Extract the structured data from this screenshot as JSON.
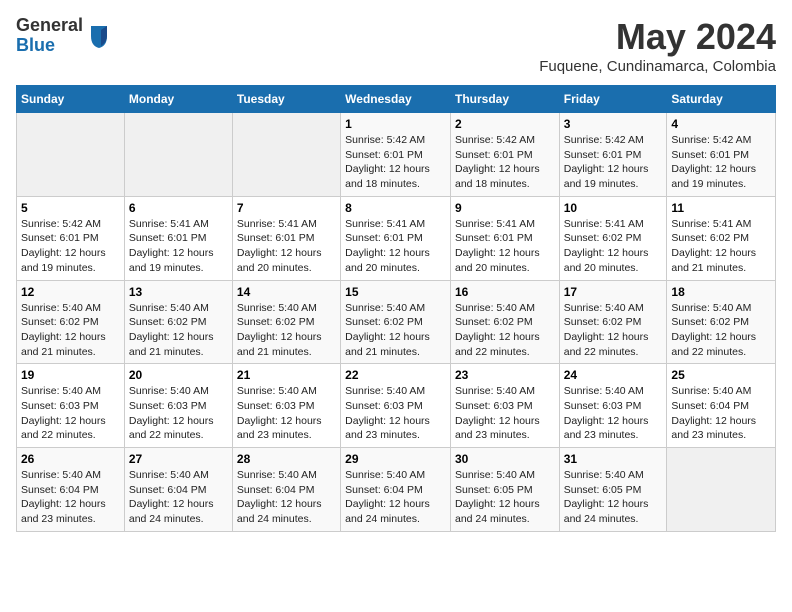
{
  "logo": {
    "general": "General",
    "blue": "Blue"
  },
  "title": "May 2024",
  "location": "Fuquene, Cundinamarca, Colombia",
  "days_of_week": [
    "Sunday",
    "Monday",
    "Tuesday",
    "Wednesday",
    "Thursday",
    "Friday",
    "Saturday"
  ],
  "weeks": [
    [
      {
        "day": "",
        "info": ""
      },
      {
        "day": "",
        "info": ""
      },
      {
        "day": "",
        "info": ""
      },
      {
        "day": "1",
        "info": "Sunrise: 5:42 AM\nSunset: 6:01 PM\nDaylight: 12 hours\nand 18 minutes."
      },
      {
        "day": "2",
        "info": "Sunrise: 5:42 AM\nSunset: 6:01 PM\nDaylight: 12 hours\nand 18 minutes."
      },
      {
        "day": "3",
        "info": "Sunrise: 5:42 AM\nSunset: 6:01 PM\nDaylight: 12 hours\nand 19 minutes."
      },
      {
        "day": "4",
        "info": "Sunrise: 5:42 AM\nSunset: 6:01 PM\nDaylight: 12 hours\nand 19 minutes."
      }
    ],
    [
      {
        "day": "5",
        "info": "Sunrise: 5:42 AM\nSunset: 6:01 PM\nDaylight: 12 hours\nand 19 minutes."
      },
      {
        "day": "6",
        "info": "Sunrise: 5:41 AM\nSunset: 6:01 PM\nDaylight: 12 hours\nand 19 minutes."
      },
      {
        "day": "7",
        "info": "Sunrise: 5:41 AM\nSunset: 6:01 PM\nDaylight: 12 hours\nand 20 minutes."
      },
      {
        "day": "8",
        "info": "Sunrise: 5:41 AM\nSunset: 6:01 PM\nDaylight: 12 hours\nand 20 minutes."
      },
      {
        "day": "9",
        "info": "Sunrise: 5:41 AM\nSunset: 6:01 PM\nDaylight: 12 hours\nand 20 minutes."
      },
      {
        "day": "10",
        "info": "Sunrise: 5:41 AM\nSunset: 6:02 PM\nDaylight: 12 hours\nand 20 minutes."
      },
      {
        "day": "11",
        "info": "Sunrise: 5:41 AM\nSunset: 6:02 PM\nDaylight: 12 hours\nand 21 minutes."
      }
    ],
    [
      {
        "day": "12",
        "info": "Sunrise: 5:40 AM\nSunset: 6:02 PM\nDaylight: 12 hours\nand 21 minutes."
      },
      {
        "day": "13",
        "info": "Sunrise: 5:40 AM\nSunset: 6:02 PM\nDaylight: 12 hours\nand 21 minutes."
      },
      {
        "day": "14",
        "info": "Sunrise: 5:40 AM\nSunset: 6:02 PM\nDaylight: 12 hours\nand 21 minutes."
      },
      {
        "day": "15",
        "info": "Sunrise: 5:40 AM\nSunset: 6:02 PM\nDaylight: 12 hours\nand 21 minutes."
      },
      {
        "day": "16",
        "info": "Sunrise: 5:40 AM\nSunset: 6:02 PM\nDaylight: 12 hours\nand 22 minutes."
      },
      {
        "day": "17",
        "info": "Sunrise: 5:40 AM\nSunset: 6:02 PM\nDaylight: 12 hours\nand 22 minutes."
      },
      {
        "day": "18",
        "info": "Sunrise: 5:40 AM\nSunset: 6:02 PM\nDaylight: 12 hours\nand 22 minutes."
      }
    ],
    [
      {
        "day": "19",
        "info": "Sunrise: 5:40 AM\nSunset: 6:03 PM\nDaylight: 12 hours\nand 22 minutes."
      },
      {
        "day": "20",
        "info": "Sunrise: 5:40 AM\nSunset: 6:03 PM\nDaylight: 12 hours\nand 22 minutes."
      },
      {
        "day": "21",
        "info": "Sunrise: 5:40 AM\nSunset: 6:03 PM\nDaylight: 12 hours\nand 23 minutes."
      },
      {
        "day": "22",
        "info": "Sunrise: 5:40 AM\nSunset: 6:03 PM\nDaylight: 12 hours\nand 23 minutes."
      },
      {
        "day": "23",
        "info": "Sunrise: 5:40 AM\nSunset: 6:03 PM\nDaylight: 12 hours\nand 23 minutes."
      },
      {
        "day": "24",
        "info": "Sunrise: 5:40 AM\nSunset: 6:03 PM\nDaylight: 12 hours\nand 23 minutes."
      },
      {
        "day": "25",
        "info": "Sunrise: 5:40 AM\nSunset: 6:04 PM\nDaylight: 12 hours\nand 23 minutes."
      }
    ],
    [
      {
        "day": "26",
        "info": "Sunrise: 5:40 AM\nSunset: 6:04 PM\nDaylight: 12 hours\nand 23 minutes."
      },
      {
        "day": "27",
        "info": "Sunrise: 5:40 AM\nSunset: 6:04 PM\nDaylight: 12 hours\nand 24 minutes."
      },
      {
        "day": "28",
        "info": "Sunrise: 5:40 AM\nSunset: 6:04 PM\nDaylight: 12 hours\nand 24 minutes."
      },
      {
        "day": "29",
        "info": "Sunrise: 5:40 AM\nSunset: 6:04 PM\nDaylight: 12 hours\nand 24 minutes."
      },
      {
        "day": "30",
        "info": "Sunrise: 5:40 AM\nSunset: 6:05 PM\nDaylight: 12 hours\nand 24 minutes."
      },
      {
        "day": "31",
        "info": "Sunrise: 5:40 AM\nSunset: 6:05 PM\nDaylight: 12 hours\nand 24 minutes."
      },
      {
        "day": "",
        "info": ""
      }
    ]
  ]
}
